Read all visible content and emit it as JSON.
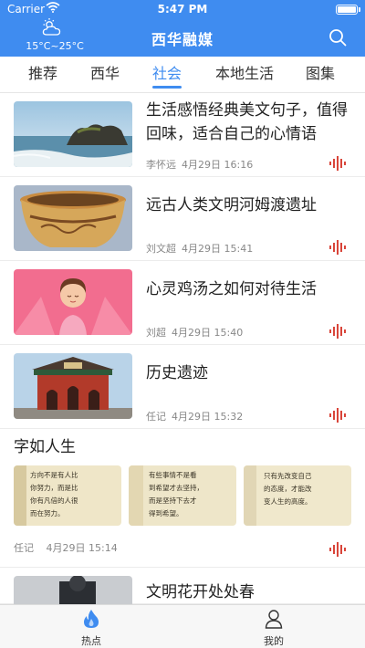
{
  "status_bar": {
    "carrier": "Carrier",
    "time": "5:47 PM"
  },
  "header": {
    "weather": "15°C~25°C",
    "brand": "西华融媒"
  },
  "tabs": [
    {
      "label": "推荐"
    },
    {
      "label": "西华"
    },
    {
      "label": "社会",
      "active": true
    },
    {
      "label": "本地生活"
    },
    {
      "label": "图集"
    }
  ],
  "articles": [
    {
      "title": "生活感悟经典美文句子，值得回味，适合自己的心情语",
      "author": "李怀远",
      "date": "4月29日 16:16",
      "image": "seaside-rocks"
    },
    {
      "title": "远古人类文明河姆渡遗址",
      "author": "刘文超",
      "date": "4月29日 15:41",
      "image": "ancient-pottery"
    },
    {
      "title": "心灵鸡汤之如何对待生活",
      "author": "刘超",
      "date": "4月29日 15:40",
      "image": "meditation-cartoon"
    },
    {
      "title": "历史遗迹",
      "author": "任记",
      "date": "4月29日 15:32",
      "image": "temple-gate"
    }
  ],
  "gallery": {
    "title": "字如人生",
    "author": "任记",
    "date": "4月29日 15:14",
    "images": [
      {
        "lines": [
          "方向不是有人比",
          "你努力，而是比",
          "你有凡倍的人很",
          "而在努力。"
        ]
      },
      {
        "lines": [
          "有些事情不是看",
          "到希望才去坚持，",
          "而是坚持下去才",
          "得到希望。"
        ]
      },
      {
        "lines": [
          "只有先改变自己",
          "的态度，才能改",
          "变人生的高度。"
        ]
      }
    ]
  },
  "partial_article": {
    "title": "文明花开处处春"
  },
  "bottom_nav": [
    {
      "label": "热点",
      "icon": "flame-icon"
    },
    {
      "label": "我的",
      "icon": "user-icon"
    }
  ],
  "colors": {
    "primary": "#3f8cf0",
    "audio": "#d9453a"
  }
}
